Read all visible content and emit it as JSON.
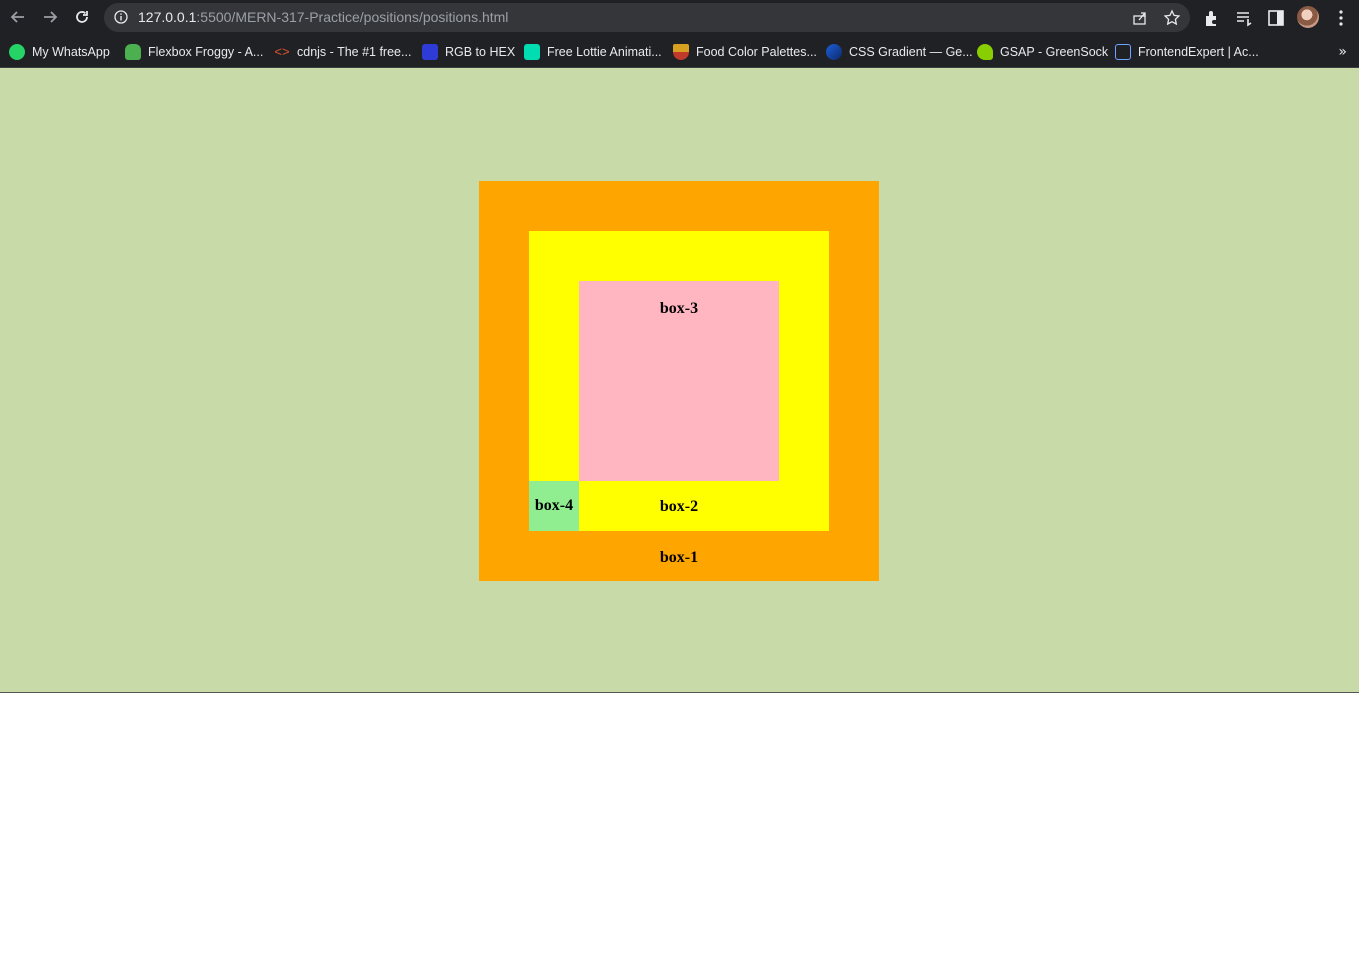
{
  "browser": {
    "url_host": "127.0.0.1",
    "url_path": ":5500/MERN-317-Practice/positions/positions.html",
    "bookmarks": [
      {
        "label": "My WhatsApp",
        "icon": "whatsapp-icon",
        "color": "#25d366"
      },
      {
        "label": "Flexbox Froggy - A...",
        "icon": "frog-icon",
        "color": "#4caf50"
      },
      {
        "label": "cdnjs - The #1 free...",
        "icon": "code-brackets-icon",
        "color": "#e0542f"
      },
      {
        "label": "RGB to HEX",
        "icon": "game-dole-icon",
        "color": "#2f3bd6"
      },
      {
        "label": "Free Lottie Animati...",
        "icon": "lottie-icon",
        "color": "#00ddb3"
      },
      {
        "label": "Food Color Palettes...",
        "icon": "food-palette-icon",
        "color": "#d8a020"
      },
      {
        "label": "CSS Gradient — Ge...",
        "icon": "gradient-icon",
        "color": "#1e5fd8"
      },
      {
        "label": "GSAP - GreenSock",
        "icon": "greensock-icon",
        "color": "#88ce02"
      },
      {
        "label": "FrontendExpert | Ac...",
        "icon": "frontendexpert-icon",
        "color": "#6ea4ff"
      }
    ]
  },
  "page": {
    "background": "#c7daa8",
    "box1": {
      "label": "box-1",
      "color": "#ffa500"
    },
    "box2": {
      "label": "box-2",
      "color": "#ffff00"
    },
    "box3": {
      "label": "box-3",
      "color": "#ffb6c1"
    },
    "box4": {
      "label": "box-4",
      "color": "#90ee90"
    }
  }
}
